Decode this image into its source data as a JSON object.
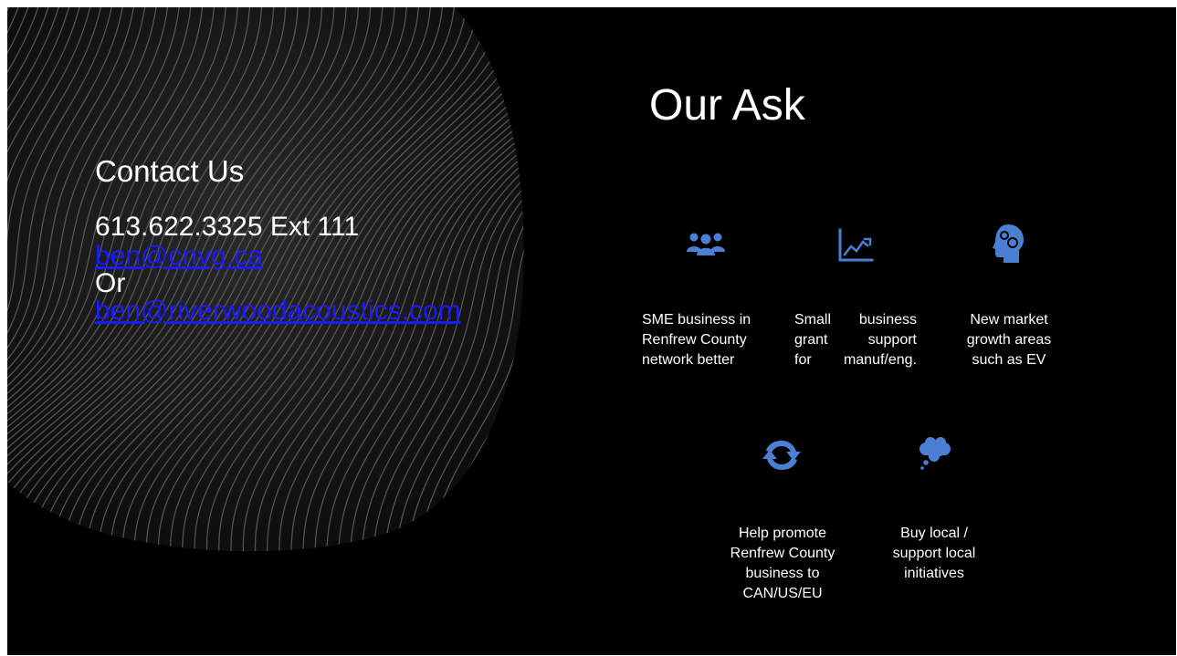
{
  "contact": {
    "title": "Contact Us",
    "phone": "613.622.3325  Ext 111",
    "email_primary": "ben@cnvg.ca",
    "or_text": "Or",
    "email_secondary": "ben@riverwoodacoustics.com"
  },
  "ask": {
    "title": "Our Ask",
    "items": [
      {
        "icon": "group-icon",
        "label": "SME business in\nRenfrew County\nnetwork better"
      },
      {
        "icon": "growth-chart-icon",
        "label": "Small business\ngrant support\nfor manuf/eng."
      },
      {
        "icon": "head-gears-icon",
        "label": "New market\ngrowth areas\nsuch as EV"
      },
      {
        "icon": "refresh-arrows-icon",
        "label": "Help promote\nRenfrew County\nbusiness to\nCAN/US/EU"
      },
      {
        "icon": "thought-cloud-icon",
        "label": "Buy local /\nsupport local\ninitiatives"
      }
    ]
  },
  "colors": {
    "background": "#000000",
    "text": "#ffffff",
    "link": "#1a1aff",
    "icon": "#4a7fd4"
  }
}
